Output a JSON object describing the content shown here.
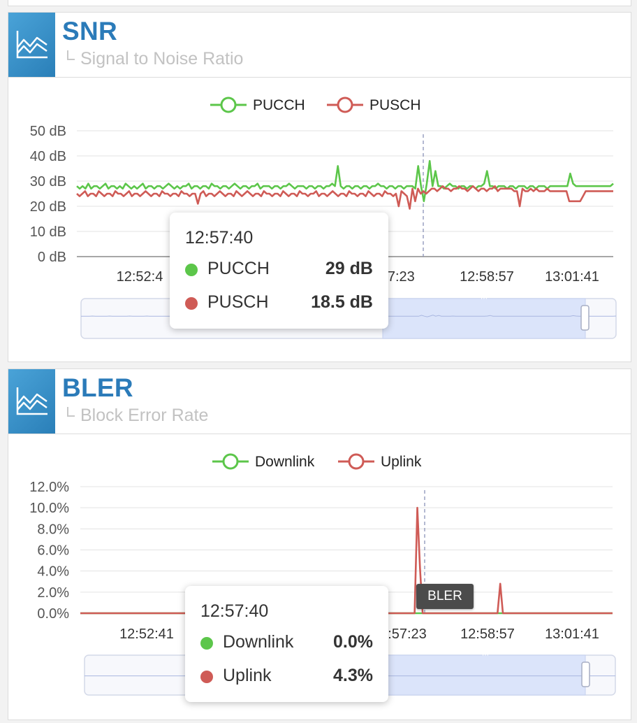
{
  "panels": {
    "snr": {
      "title": "SNR",
      "subtitle": "Signal to Noise Ratio"
    },
    "bler": {
      "title": "BLER",
      "subtitle": "Block Error Rate"
    }
  },
  "colors": {
    "green": "#5cc64a",
    "red": "#cf5b56",
    "header": "#2b7bb9",
    "icon_bg": "#3a8fc8"
  },
  "snr_tooltip": {
    "time": "12:57:40",
    "rows": [
      {
        "name": "PUCCH",
        "value": "29 dB"
      },
      {
        "name": "PUSCH",
        "value": "18.5 dB"
      }
    ]
  },
  "bler_tooltip": {
    "time": "12:57:40",
    "rows": [
      {
        "name": "Downlink",
        "value": "0.0%"
      },
      {
        "name": "Uplink",
        "value": "4.3%"
      }
    ]
  },
  "bler_badge": "BLER",
  "chart_data": [
    {
      "type": "line",
      "ylim": [
        0,
        50
      ],
      "y_ticks": [
        "0 dB",
        "10 dB",
        "20 dB",
        "30 dB",
        "40 dB",
        "50 dB"
      ],
      "x_ticks": [
        "12:52:4",
        ":57:23",
        "12:58:57",
        "13:01:41"
      ],
      "grid": true,
      "legend_position": "top-center",
      "hover_time": "12:57:40",
      "navigator": true,
      "series": [
        {
          "name": "PUCCH",
          "color": "#5cc64a",
          "values": [
            28,
            27,
            28,
            27,
            29,
            27,
            28,
            28,
            27,
            28,
            29,
            27,
            28,
            28,
            27,
            28,
            27,
            29,
            28,
            27,
            28,
            27,
            28,
            29,
            27,
            28,
            28,
            27,
            28,
            28,
            27,
            28,
            29,
            28,
            27,
            28,
            27,
            28,
            28,
            29,
            27,
            28,
            28,
            27,
            28,
            28,
            27,
            29,
            28,
            28,
            27,
            28,
            28,
            27,
            28,
            29,
            28,
            27,
            28,
            28,
            27,
            28,
            28,
            29,
            27,
            28,
            28,
            28,
            27,
            28,
            28,
            27,
            28,
            28,
            29,
            28,
            27,
            28,
            28,
            28,
            27,
            28,
            28,
            27,
            28,
            28,
            27,
            28,
            28,
            29,
            28,
            36,
            28,
            27,
            28,
            28,
            27,
            28,
            28,
            27,
            28,
            28,
            27,
            28,
            28,
            29,
            28,
            28,
            27,
            28,
            28,
            27,
            28,
            28,
            27,
            28,
            28,
            28,
            27,
            36,
            28,
            22,
            29,
            38,
            28,
            34,
            28,
            28,
            27,
            28,
            29,
            28,
            28,
            27,
            28,
            28,
            27,
            28,
            28,
            27,
            28,
            28,
            29,
            34,
            28,
            28,
            27,
            28,
            28,
            28,
            27,
            28,
            28,
            27,
            28,
            28,
            28,
            27,
            28,
            28,
            27,
            28,
            28,
            28,
            27,
            28,
            28,
            28,
            28,
            28,
            28,
            28,
            33,
            29,
            28,
            28,
            28,
            28,
            28,
            28,
            28,
            28,
            28,
            28,
            28,
            28,
            28,
            29
          ]
        },
        {
          "name": "PUSCH",
          "color": "#cf5b56",
          "values": [
            25,
            24,
            25,
            26,
            24,
            25,
            25,
            24,
            26,
            25,
            24,
            25,
            25,
            24,
            26,
            25,
            25,
            24,
            25,
            26,
            24,
            25,
            25,
            24,
            25,
            26,
            25,
            24,
            25,
            25,
            24,
            26,
            25,
            25,
            24,
            25,
            25,
            24,
            26,
            25,
            25,
            24,
            25,
            25,
            21,
            25,
            26,
            24,
            25,
            25,
            24,
            25,
            26,
            25,
            24,
            25,
            25,
            24,
            26,
            25,
            24,
            25,
            26,
            25,
            24,
            25,
            25,
            24,
            26,
            25,
            25,
            24,
            25,
            25,
            24,
            26,
            25,
            24,
            25,
            25,
            24,
            26,
            25,
            25,
            24,
            25,
            25,
            26,
            24,
            25,
            25,
            24,
            25,
            26,
            25,
            24,
            25,
            25,
            24,
            26,
            25,
            25,
            24,
            25,
            25,
            24,
            26,
            25,
            24,
            25,
            25,
            24,
            26,
            25,
            25,
            24,
            25,
            20,
            26,
            25,
            24,
            19,
            27,
            22,
            27,
            25,
            26,
            25,
            26,
            27,
            27,
            26,
            27,
            28,
            27,
            27,
            26,
            27,
            27,
            28,
            27,
            27,
            26,
            27,
            28,
            27,
            26,
            27,
            27,
            26,
            27,
            27,
            28,
            26,
            27,
            27,
            27,
            27,
            27,
            26,
            26,
            20,
            27,
            26,
            26,
            27,
            26,
            27,
            26,
            26,
            26,
            27,
            26,
            26,
            26,
            26,
            26,
            26,
            26,
            22,
            22,
            22,
            22,
            22,
            24,
            26,
            26,
            26,
            26,
            26,
            26,
            26,
            26,
            26,
            26,
            26
          ]
        }
      ]
    },
    {
      "type": "line",
      "ylim": [
        0,
        12
      ],
      "y_ticks": [
        "0.0%",
        "2.0%",
        "4.0%",
        "6.0%",
        "8.0%",
        "10.0%",
        "12.0%"
      ],
      "x_ticks": [
        "12:52:41",
        ":57:23",
        "12:58:57",
        "13:01:41"
      ],
      "grid": true,
      "legend_position": "top-center",
      "hover_time": "12:57:40",
      "navigator": true,
      "series": [
        {
          "name": "Downlink",
          "color": "#5cc64a",
          "values": [
            0,
            0,
            0,
            0,
            0,
            0,
            0,
            0,
            0,
            0,
            0,
            0,
            0,
            0,
            0,
            0,
            0,
            0,
            0,
            0,
            0,
            0,
            0,
            0,
            0,
            0,
            0,
            0,
            0,
            0,
            0,
            0,
            0,
            0,
            0,
            0,
            0,
            0,
            0,
            0,
            0,
            0,
            0,
            0,
            0,
            0,
            0,
            0,
            0,
            0,
            0,
            0,
            0,
            0,
            0,
            0,
            0,
            0,
            0,
            0,
            0,
            0,
            0,
            0,
            0,
            0,
            0,
            0,
            0,
            0,
            0,
            0,
            0,
            0,
            0,
            0,
            0,
            0,
            0,
            0,
            0,
            0,
            0,
            0,
            0,
            0,
            0,
            0,
            0,
            0,
            0,
            0,
            0,
            0,
            0,
            0,
            0,
            0,
            0,
            0,
            0,
            0,
            0,
            0,
            0,
            0,
            0,
            0,
            0,
            0,
            0,
            0,
            0,
            0,
            0,
            0,
            0,
            0,
            0,
            0,
            0,
            0,
            0,
            0,
            0,
            0,
            0,
            0,
            0,
            0,
            0,
            0,
            0,
            0,
            0,
            0,
            0,
            0,
            0,
            0,
            0,
            0,
            0,
            0,
            0,
            0,
            0,
            0,
            0,
            0,
            0,
            0,
            0,
            0,
            0,
            0,
            0,
            0,
            0,
            0,
            0,
            0,
            0,
            0,
            0,
            0,
            0,
            0,
            0,
            0,
            0,
            0,
            0,
            0,
            0,
            0,
            0,
            0,
            0,
            0,
            0,
            0,
            0,
            0,
            0,
            0,
            0,
            0,
            0,
            0,
            0,
            0,
            0,
            0,
            0,
            0,
            0,
            0,
            0,
            0
          ]
        },
        {
          "name": "Uplink",
          "color": "#cf5b56",
          "values": [
            0,
            0,
            0,
            0,
            0,
            0,
            0,
            0,
            0,
            0,
            0,
            0,
            0,
            0,
            0,
            0,
            0,
            0,
            0,
            0,
            0,
            0,
            0,
            0,
            0,
            0,
            0,
            0,
            0,
            0,
            0,
            0,
            0,
            0,
            0,
            0,
            0,
            0,
            0,
            0,
            0,
            0,
            0,
            0,
            0,
            0,
            0,
            0,
            0,
            0,
            0,
            0,
            0,
            0,
            0,
            0,
            0,
            0,
            0,
            0,
            0,
            0,
            0,
            0,
            0,
            0,
            0,
            0,
            0,
            0,
            0,
            0,
            0,
            0,
            0,
            0,
            0,
            0,
            0,
            0,
            0,
            0,
            0,
            0,
            0,
            0,
            0,
            0,
            0,
            0,
            0,
            0,
            0,
            0,
            0,
            0,
            0,
            0,
            0,
            0,
            0,
            0,
            0,
            0,
            0,
            0,
            0,
            0,
            0,
            0,
            0,
            0,
            0,
            0,
            0,
            0,
            0,
            0,
            0,
            0,
            0,
            0,
            0,
            0,
            0,
            0,
            0,
            0,
            0,
            0,
            0,
            0,
            0,
            0,
            0,
            0,
            0,
            0,
            0,
            0,
            0,
            0,
            0,
            0,
            0,
            0,
            0,
            0,
            0,
            0,
            0,
            0,
            0,
            0,
            0,
            0,
            0,
            0,
            0,
            0,
            0,
            0,
            0,
            0,
            0,
            0,
            0,
            0,
            0,
            0,
            0,
            0,
            0,
            0,
            0,
            0,
            0,
            0,
            0,
            0,
            0,
            0,
            0,
            0,
            0,
            0,
            0,
            0,
            0,
            0,
            0,
            0,
            0,
            0,
            0,
            0,
            0,
            0,
            0,
            0
          ]
        }
      ]
    }
  ]
}
